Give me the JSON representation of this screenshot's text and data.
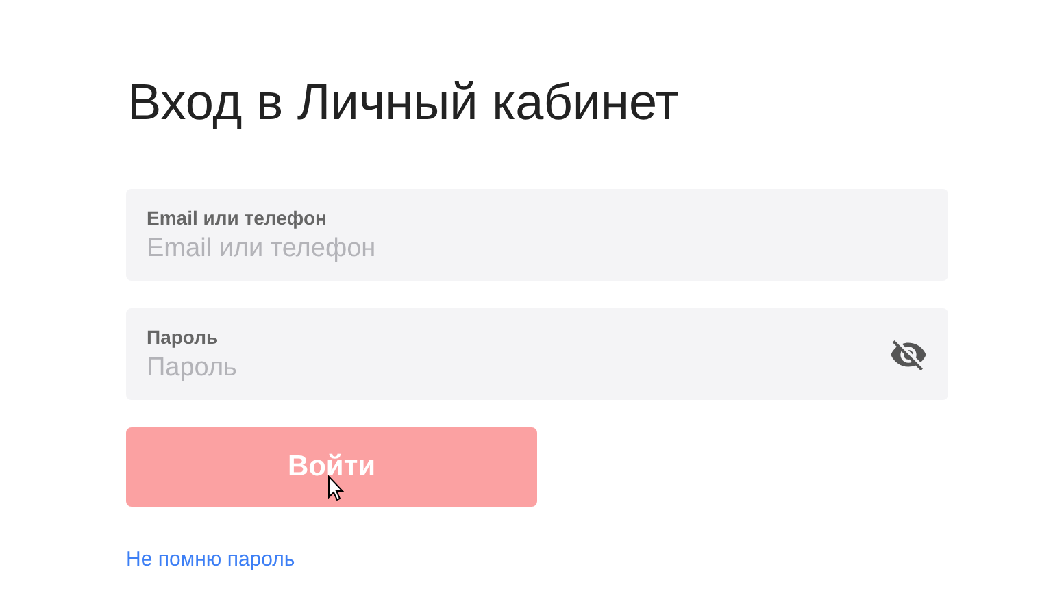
{
  "title": "Вход в Личный кабинет",
  "fields": [
    {
      "label": "Email или телефон",
      "placeholder": "Email или телефон",
      "kind": "text"
    },
    {
      "label": "Пароль",
      "placeholder": "Пароль",
      "kind": "password"
    }
  ],
  "submit": {
    "label": "Войти",
    "disabled": true
  },
  "link": "Не помню пароль"
}
